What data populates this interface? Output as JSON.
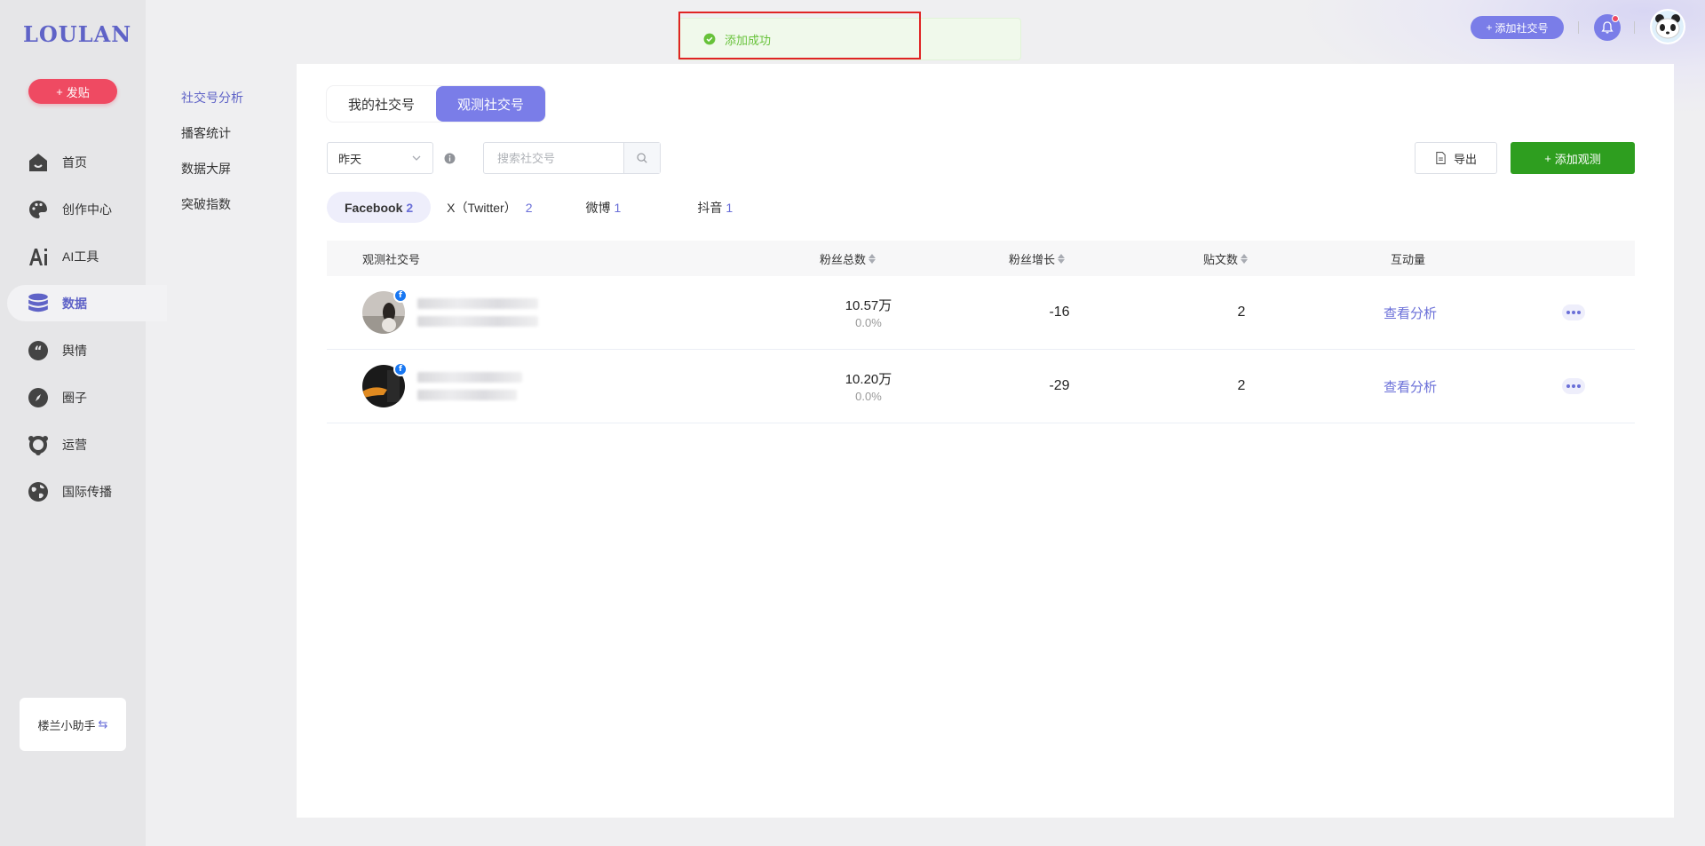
{
  "brand": {
    "logo": "LOULAN"
  },
  "sidebar": {
    "post_button": "发贴",
    "items": [
      {
        "label": "首页",
        "icon": "home-icon"
      },
      {
        "label": "创作中心",
        "icon": "palette-icon"
      },
      {
        "label": "AI工具",
        "icon": "ai-icon"
      },
      {
        "label": "数据",
        "icon": "database-icon",
        "active": true
      },
      {
        "label": "舆情",
        "icon": "quote-icon"
      },
      {
        "label": "圈子",
        "icon": "compass-icon"
      },
      {
        "label": "运营",
        "icon": "operations-icon"
      },
      {
        "label": "国际传播",
        "icon": "globe-icon"
      }
    ],
    "assistant": "楼兰小助手"
  },
  "subnav": {
    "items": [
      {
        "label": "社交号分析",
        "active": true
      },
      {
        "label": "播客统计"
      },
      {
        "label": "数据大屏"
      },
      {
        "label": "突破指数"
      }
    ]
  },
  "header": {
    "add_social_button": "添加社交号",
    "has_notification": true
  },
  "toast": {
    "message": "添加成功",
    "type": "success"
  },
  "main": {
    "segments": [
      {
        "label": "我的社交号"
      },
      {
        "label": "观测社交号",
        "active": true
      }
    ],
    "date_select": {
      "value": "昨天"
    },
    "search": {
      "placeholder": "搜索社交号"
    },
    "export_button": "导出",
    "add_watch_button": "添加观测",
    "platform_tabs": [
      {
        "label": "Facebook",
        "count": "2",
        "active": true
      },
      {
        "label": "X（Twitter）",
        "count": "2"
      },
      {
        "label": "微博",
        "count": "1"
      },
      {
        "label": "抖音",
        "count": "1"
      }
    ],
    "table": {
      "columns": {
        "account": "观测社交号",
        "fans_total": "粉丝总数",
        "fans_growth": "粉丝增长",
        "posts": "贴文数",
        "interactions": "互动量"
      },
      "rows": [
        {
          "fans_total": "10.57万",
          "fans_pct": "0.0%",
          "growth": "-16",
          "posts": "2",
          "action": "查看分析",
          "platform": "facebook"
        },
        {
          "fans_total": "10.20万",
          "fans_pct": "0.0%",
          "growth": "-29",
          "posts": "2",
          "action": "查看分析",
          "platform": "facebook"
        }
      ]
    }
  },
  "colors": {
    "accent": "#7a7de8",
    "primary_text": "#5f63c7",
    "post_button": "#ef4a62",
    "add_watch": "#2e9e1f",
    "toast_success": "#67c23a",
    "highlight_box": "#e02424"
  }
}
